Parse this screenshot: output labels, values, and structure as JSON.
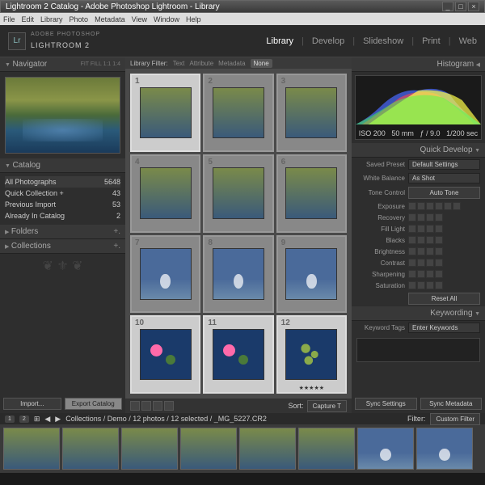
{
  "window": {
    "title": "Lightroom 2 Catalog - Adobe Photoshop Lightroom - Library"
  },
  "menu": [
    "File",
    "Edit",
    "Library",
    "Photo",
    "Metadata",
    "View",
    "Window",
    "Help"
  ],
  "app": {
    "sub": "ADOBE PHOTOSHOP",
    "name": "LIGHTROOM 2",
    "logo": "Lr"
  },
  "modules": [
    "Library",
    "Develop",
    "Slideshow",
    "Print",
    "Web"
  ],
  "navigator": {
    "title": "Navigator",
    "opts": "FIT  FILL  1:1  1:4"
  },
  "catalog": {
    "title": "Catalog",
    "items": [
      {
        "name": "All Photographs",
        "count": "5648"
      },
      {
        "name": "Quick Collection  +",
        "count": "43"
      },
      {
        "name": "Previous Import",
        "count": "53"
      },
      {
        "name": "Already In Catalog",
        "count": "2"
      }
    ]
  },
  "folders": {
    "title": "Folders"
  },
  "collections": {
    "title": "Collections"
  },
  "import": "Import...",
  "export": "Export Catalog",
  "filter": {
    "label": "Library Filter:",
    "opts": [
      "Text",
      "Attribute",
      "Metadata",
      "None"
    ]
  },
  "sort": {
    "label": "Sort:",
    "value": "Capture T"
  },
  "histogram": {
    "title": "Histogram",
    "iso": "ISO 200",
    "focal": "50 mm",
    "aperture": "ƒ / 9.0",
    "shutter": "1/200 sec"
  },
  "quickdev": {
    "title": "Quick Develop",
    "preset": {
      "lbl": "Saved Preset",
      "val": "Default Settings"
    },
    "wb": {
      "lbl": "White Balance",
      "val": "As Shot"
    },
    "tone": {
      "lbl": "Tone Control",
      "val": "Auto Tone"
    },
    "sliders": [
      "Exposure",
      "Recovery",
      "Fill Light",
      "Blacks",
      "Brightness",
      "Contrast",
      "Sharpening",
      "Saturation"
    ],
    "reset": "Reset All"
  },
  "keywording": {
    "title": "Keywording",
    "tags": "Keyword Tags",
    "enter": "Enter Keywords"
  },
  "sync": {
    "settings": "Sync Settings",
    "metadata": "Sync Metadata"
  },
  "filmbar": {
    "path": "Collections / Demo / 12 photos / 12 selected / _MG_5227.CR2",
    "filter": "Filter:",
    "custom": "Custom Filter"
  }
}
